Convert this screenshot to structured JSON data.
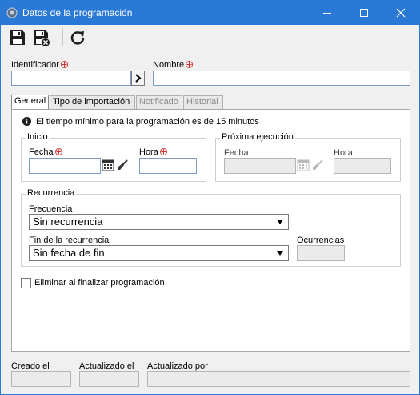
{
  "window": {
    "title": "Datos de la programación"
  },
  "form": {
    "identificador_label": "Identificador",
    "nombre_label": "Nombre",
    "identificador_value": "",
    "nombre_value": ""
  },
  "tabs": [
    {
      "label": "General",
      "state": "active"
    },
    {
      "label": "Tipo de importación",
      "state": "enabled"
    },
    {
      "label": "Notificado",
      "state": "disabled"
    },
    {
      "label": "Historial",
      "state": "disabled"
    }
  ],
  "general": {
    "info_text": "El tiempo mínimo para la programación es de 15 minutos",
    "inicio": {
      "title": "Inicio",
      "fecha_label": "Fecha",
      "hora_label": "Hora",
      "fecha_value": "",
      "hora_value": ""
    },
    "proxima": {
      "title": "Próxima ejecución",
      "fecha_label": "Fecha",
      "hora_label": "Hora",
      "fecha_value": "",
      "hora_value": ""
    },
    "recurrencia": {
      "title": "Recurrencia",
      "frecuencia_label": "Frecuencia",
      "frecuencia_value": "Sin recurrencia",
      "fin_label": "Fin de la recurrencia",
      "fin_value": "Sin fecha de fin",
      "ocurrencias_label": "Ocurrencias",
      "ocurrencias_value": ""
    },
    "eliminar_label": "Eliminar al finalizar programación",
    "eliminar_checked": false
  },
  "footer": {
    "creado_label": "Creado el",
    "actualizado_label": "Actualizado el",
    "actualizado_por_label": "Actualizado por"
  },
  "colors": {
    "titlebar": "#2b79d7",
    "required": "#d0312d"
  }
}
